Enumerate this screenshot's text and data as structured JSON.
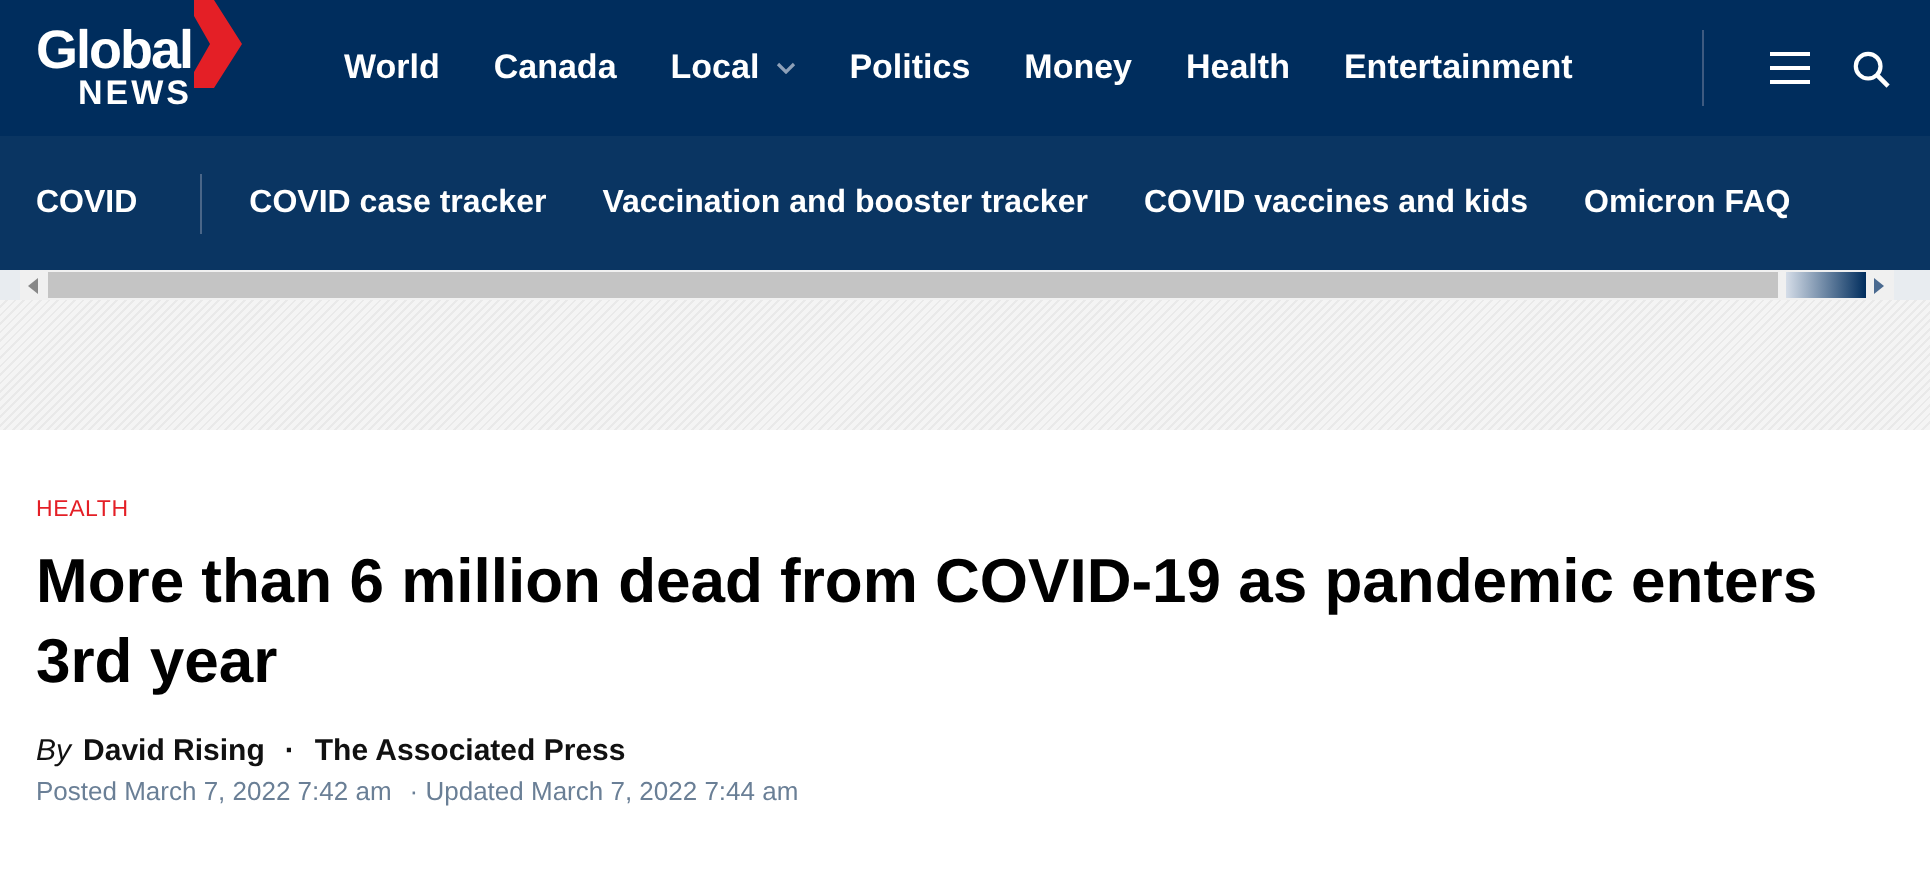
{
  "logo": {
    "line_1": "Global",
    "line_2": "NEWS"
  },
  "main_nav": [
    {
      "label": "World",
      "has_dropdown": false
    },
    {
      "label": "Canada",
      "has_dropdown": false
    },
    {
      "label": "Local",
      "has_dropdown": true
    },
    {
      "label": "Politics",
      "has_dropdown": false
    },
    {
      "label": "Money",
      "has_dropdown": false
    },
    {
      "label": "Health",
      "has_dropdown": false
    },
    {
      "label": "Entertainment",
      "has_dropdown": false
    }
  ],
  "sub_nav": {
    "section": "COVID",
    "links": [
      "COVID case tracker",
      "Vaccination and booster tracker",
      "COVID vaccines and kids",
      "Omicron FAQ"
    ]
  },
  "article": {
    "category": "HEALTH",
    "headline": "More than 6 million dead from COVID-19 as pandemic enters 3rd year",
    "byline_prefix": "By",
    "author": "David Rising",
    "separator": "·",
    "source": "The Associated Press",
    "posted": "Posted March 7, 2022 7:42 am",
    "updated": "· Updated March 7, 2022 7:44 am"
  }
}
